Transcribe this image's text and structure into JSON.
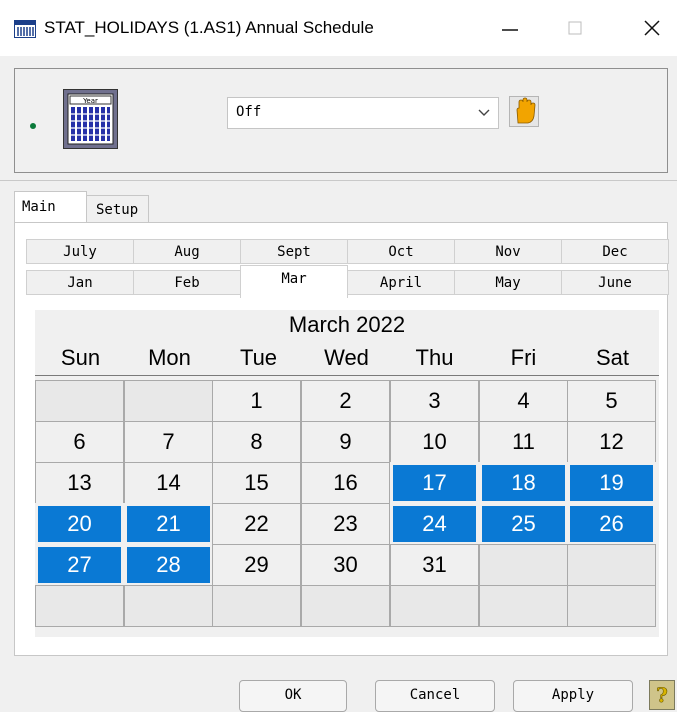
{
  "window": {
    "title": "STAT_HOLIDAYS  (1.AS1)  Annual Schedule",
    "minimize_glyph": "—",
    "maximize_glyph": "☐",
    "close_glyph": "✕"
  },
  "top_panel": {
    "status_color": "#0b7a3a",
    "year_icon_text": "Year",
    "schedule_mode": "Off"
  },
  "tabs": {
    "main": "Main",
    "setup": "Setup"
  },
  "month_tabs": {
    "row1": [
      "July",
      "Aug",
      "Sept",
      "Oct",
      "Nov",
      "Dec"
    ],
    "row2": [
      "Jan",
      "Feb",
      "Mar",
      "April",
      "May",
      "June"
    ],
    "selected": "Mar"
  },
  "calendar": {
    "title": "March 2022",
    "weekdays": [
      "Sun",
      "Mon",
      "Tue",
      "Wed",
      "Thu",
      "Fri",
      "Sat"
    ],
    "weeks": [
      [
        "",
        "",
        "1",
        "2",
        "3",
        "4",
        "5"
      ],
      [
        "6",
        "7",
        "8",
        "9",
        "10",
        "11",
        "12"
      ],
      [
        "13",
        "14",
        "15",
        "16",
        "17",
        "18",
        "19"
      ],
      [
        "20",
        "21",
        "22",
        "23",
        "24",
        "25",
        "26"
      ],
      [
        "27",
        "28",
        "29",
        "30",
        "31",
        "",
        ""
      ],
      [
        "",
        "",
        "",
        "",
        "",
        "",
        ""
      ]
    ],
    "holidays": [
      "17",
      "18",
      "19",
      "20",
      "21",
      "24",
      "25",
      "26",
      "27",
      "28"
    ],
    "holiday_color": "#0a79d4"
  },
  "buttons": {
    "ok": "OK",
    "cancel": "Cancel",
    "apply": "Apply"
  }
}
